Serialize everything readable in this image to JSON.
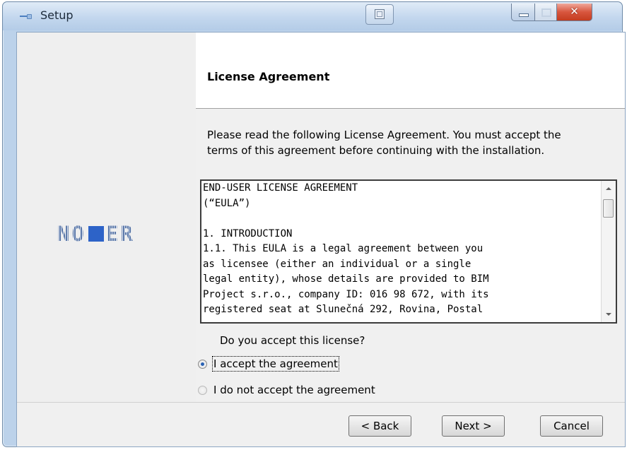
{
  "window": {
    "title": "Setup"
  },
  "logo": {
    "brand_before": "NO",
    "brand_after": "ER"
  },
  "header": {
    "title": "License Agreement"
  },
  "intro": {
    "line1": "Please read the following License Agreement. You must accept the",
    "line2": "terms of this agreement before continuing with the installation."
  },
  "eula": {
    "text": "END-USER LICENSE AGREEMENT\n(“EULA”)\n\n1. INTRODUCTION\n1.1. This EULA is a legal agreement between you\nas licensee (either an individual or a single\nlegal entity), whose details are provided to BIM\nProject s.r.o., company ID: 016 98 672, with its\nregistered seat at Slunečná 292, Rovina, Postal"
  },
  "question": {
    "label": "Do you accept this license?"
  },
  "options": [
    {
      "label": "I accept the agreement",
      "selected": true
    },
    {
      "label": "I do not accept the agreement",
      "selected": false
    }
  ],
  "buttons": {
    "back": "< Back",
    "next": "Next >",
    "cancel": "Cancel"
  },
  "icons": {
    "app": "setup-app-icon",
    "glass": "monitor-icon",
    "minimize": "minimize-icon",
    "maximize": "maximize-icon",
    "close": "close-icon"
  },
  "colors": {
    "logo_blue": "#2d63c8",
    "close_red": "#c43c1f",
    "radio_dot": "#2a62b3"
  }
}
